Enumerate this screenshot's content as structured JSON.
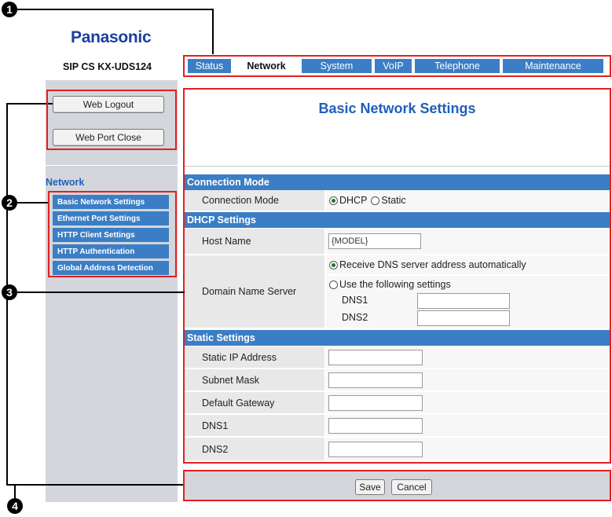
{
  "callouts": [
    "1",
    "2",
    "3",
    "4"
  ],
  "header": {
    "brand": "Panasonic",
    "model": "SIP CS KX-UDS124"
  },
  "tabs": [
    {
      "label": "Status",
      "active": false
    },
    {
      "label": "Network",
      "active": true
    },
    {
      "label": "System",
      "active": false
    },
    {
      "label": "VoIP",
      "active": false
    },
    {
      "label": "Telephone",
      "active": false
    },
    {
      "label": "Maintenance",
      "active": false
    }
  ],
  "sidebar": {
    "logout_label": "Web Logout",
    "port_close_label": "Web Port Close",
    "section_label": "Network",
    "items": [
      {
        "label": "Basic Network Settings"
      },
      {
        "label": "Ethernet Port Settings"
      },
      {
        "label": "HTTP Client Settings"
      },
      {
        "label": "HTTP Authentication"
      },
      {
        "label": "Global Address Detection"
      }
    ]
  },
  "main": {
    "title": "Basic Network Settings",
    "connection": {
      "section": "Connection Mode",
      "label": "Connection Mode",
      "opt_dhcp": "DHCP",
      "opt_static": "Static",
      "selected": "DHCP"
    },
    "dhcp": {
      "section": "DHCP Settings",
      "host_label": "Host Name",
      "host_value": "{MODEL}",
      "dns_label": "Domain Name Server",
      "dns_auto": "Receive DNS server address automatically",
      "dns_manual": "Use the following settings",
      "dns1_label": "DNS1",
      "dns2_label": "DNS2",
      "dns1_value": "",
      "dns2_value": ""
    },
    "static": {
      "section": "Static Settings",
      "fields": [
        {
          "label": "Static IP Address",
          "value": ""
        },
        {
          "label": "Subnet Mask",
          "value": ""
        },
        {
          "label": "Default Gateway",
          "value": ""
        },
        {
          "label": "DNS1",
          "value": ""
        },
        {
          "label": "DNS2",
          "value": ""
        }
      ]
    }
  },
  "footer": {
    "save_label": "Save",
    "cancel_label": "Cancel"
  },
  "colors": {
    "brand": "#1a3f9e",
    "accent": "#3b7ec5",
    "highlight": "#e02020",
    "panel": "#d4d6db"
  }
}
